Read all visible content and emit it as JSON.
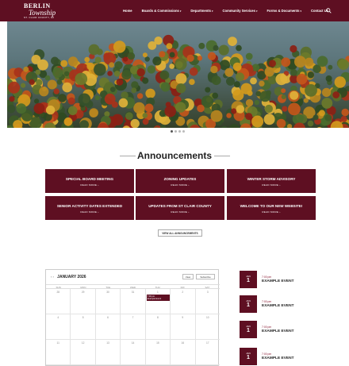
{
  "logo": {
    "line1": "BERLIN",
    "line2": "Township",
    "line3": "ST. CLAIR COUNTY, MI"
  },
  "nav": [
    {
      "label": "Home",
      "dropdown": false
    },
    {
      "label": "Boards & Commissions",
      "dropdown": true
    },
    {
      "label": "Departments",
      "dropdown": true
    },
    {
      "label": "Community Services",
      "dropdown": true
    },
    {
      "label": "Forms & Documents",
      "dropdown": true
    },
    {
      "label": "Contact Us",
      "dropdown": false
    }
  ],
  "icons": {
    "search": "search-icon"
  },
  "colors": {
    "brand": "#5e0f22",
    "accent_text": "#8a1a33"
  },
  "slider": {
    "dot_count": 4,
    "active_index": 0
  },
  "announcements": {
    "title": "Announcements",
    "read_more": "READ MORE",
    "cards": [
      {
        "title": "SPECIAL BOARD MEETING"
      },
      {
        "title": "ZONING UPDATES"
      },
      {
        "title": "WINTER STORM ADVISORY"
      },
      {
        "title": "SENIOR ACTIVITY DATES EXTENDED"
      },
      {
        "title": "UPDATES FROM ST CLAIR COUNTY"
      },
      {
        "title": "WELCOME TO OUR NEW WEBSITE!"
      }
    ],
    "view_all": "VIEW ALL ANNOUNCEMENTS"
  },
  "calendar": {
    "month": "JANUARY 2026",
    "nav_arrows": "‹ ›",
    "buttons": {
      "view": "View",
      "subscribe": "Subscribe"
    },
    "days_of_week": [
      "SUN",
      "MON",
      "TUE",
      "WED",
      "THU",
      "FRI",
      "SAT"
    ],
    "weeks": [
      [
        "28",
        "29",
        "30",
        "31",
        "1",
        "2",
        "3"
      ],
      [
        "4",
        "5",
        "6",
        "7",
        "8",
        "9",
        "10"
      ],
      [
        "11",
        "12",
        "13",
        "14",
        "15",
        "16",
        "17"
      ]
    ],
    "event": {
      "time": "7:00 pm",
      "title": "Example Event",
      "week": 0,
      "day": 4
    }
  },
  "events": [
    {
      "month": "JAN",
      "day": "1",
      "time": "7:00 pm",
      "title": "EXAMPLE EVENT"
    },
    {
      "month": "JAN",
      "day": "1",
      "time": "7:00 pm",
      "title": "EXAMPLE EVENT"
    },
    {
      "month": "JAN",
      "day": "1",
      "time": "7:00 pm",
      "title": "EXAMPLE EVENT"
    },
    {
      "month": "JAN",
      "day": "1",
      "time": "7:00 pm",
      "title": "EXAMPLE EVENT"
    }
  ]
}
